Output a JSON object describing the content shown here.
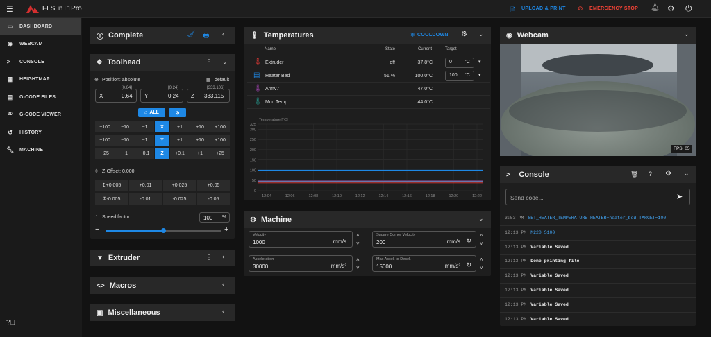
{
  "app": {
    "title": "FLSunT1Pro",
    "upload_label": "UPLOAD & PRINT",
    "estop_label": "EMERGENCY STOP"
  },
  "colors": {
    "accent": "#1e88e5",
    "danger": "#f44336",
    "brand": "#d32f2f"
  },
  "nav": [
    {
      "label": "DASHBOARD",
      "icon": "dashboard-icon"
    },
    {
      "label": "WEBCAM",
      "icon": "webcam-icon"
    },
    {
      "label": "CONSOLE",
      "icon": "console-icon"
    },
    {
      "label": "HEIGHTMAP",
      "icon": "heightmap-icon"
    },
    {
      "label": "G-CODE FILES",
      "icon": "files-icon"
    },
    {
      "label": "G-CODE VIEWER",
      "icon": "3d-icon"
    },
    {
      "label": "HISTORY",
      "icon": "history-icon"
    },
    {
      "label": "MACHINE",
      "icon": "wrench-icon"
    }
  ],
  "status": {
    "title": "Complete"
  },
  "toolhead": {
    "title": "Toolhead",
    "position_mode": "Position: absolute",
    "profile": "default",
    "axes": [
      {
        "name": "X",
        "value": "0.64",
        "live": "[0.64]"
      },
      {
        "name": "Y",
        "value": "0.24",
        "live": "[0.24]"
      },
      {
        "name": "Z",
        "value": "333.115",
        "live": "[333.106]"
      }
    ],
    "home_all": "ALL",
    "x_row": [
      "−100",
      "−10",
      "−1",
      "X",
      "+1",
      "+10",
      "+100"
    ],
    "y_row": [
      "−100",
      "−10",
      "−1",
      "Y",
      "+1",
      "+10",
      "+100"
    ],
    "z_row": [
      "−25",
      "−1",
      "−0.1",
      "Z",
      "+0.1",
      "+1",
      "+25"
    ],
    "zoffset_label": "Z-Offset: 0.000",
    "zoff_up": [
      "+0.005",
      "+0.01",
      "+0.025",
      "+0.05"
    ],
    "zoff_down": [
      "-0.005",
      "-0.01",
      "-0.025",
      "-0.05"
    ],
    "speed_label": "Speed factor",
    "speed_value": "100",
    "speed_unit": "%",
    "speed_fraction": 0.5,
    "minus": "−",
    "plus": "+"
  },
  "panels": {
    "extruder": "Extruder",
    "macros": "Macros",
    "misc": "Miscellaneous",
    "machine": "Machine",
    "webcam": "Webcam",
    "console": "Console"
  },
  "temps": {
    "title": "Temperatures",
    "cooldown": "COOLDOWN",
    "headers": [
      "Name",
      "State",
      "Current",
      "Target"
    ],
    "rows": [
      {
        "name": "Extruder",
        "state": "off",
        "current": "37.8°C",
        "target": "0",
        "unit": "°C",
        "color": "#e53935"
      },
      {
        "name": "Heater Bed",
        "state": "51 %",
        "current": "100.0°C",
        "target": "100",
        "unit": "°C",
        "color": "#1e88e5"
      },
      {
        "name": "Armv7",
        "state": "",
        "current": "47.0°C",
        "target": "",
        "unit": "",
        "color": "#ab47bc"
      },
      {
        "name": "Mcu Temp",
        "state": "",
        "current": "44.0°C",
        "target": "",
        "unit": "",
        "color": "#26a69a"
      }
    ]
  },
  "chart_data": {
    "type": "line",
    "ylabel": "Temperature [°C]",
    "ylim": [
      0,
      325
    ],
    "yticks": [
      "325",
      "300",
      "250",
      "200",
      "150",
      "100",
      "50",
      "0"
    ],
    "x": [
      "12:04",
      "12:06",
      "12:08",
      "12:10",
      "12:12",
      "12:14",
      "12:16",
      "12:18",
      "12:20",
      "12:22"
    ],
    "series": [
      {
        "name": "Heater Bed",
        "values": [
          100,
          100,
          100,
          100,
          100,
          100,
          100,
          100,
          100,
          100
        ],
        "color": "#1e88e5"
      },
      {
        "name": "Armv7",
        "values": [
          47,
          47,
          47,
          47,
          47,
          47,
          47,
          47,
          47,
          47
        ],
        "color": "#ab47bc"
      },
      {
        "name": "Mcu Temp",
        "values": [
          44,
          44,
          44,
          44,
          44,
          44,
          44,
          44,
          44,
          44
        ],
        "color": "#26a69a"
      },
      {
        "name": "Extruder",
        "values": [
          38,
          38,
          38,
          38,
          38,
          38,
          38,
          38,
          38,
          38
        ],
        "color": "#e53935"
      }
    ]
  },
  "machine": {
    "fields": [
      {
        "label": "Velocity",
        "value": "1000",
        "unit": "mm/s"
      },
      {
        "label": "Square Corner Velocity",
        "value": "200",
        "unit": "mm/s"
      },
      {
        "label": "Acceleration",
        "value": "30000",
        "unit": "mm/s²"
      },
      {
        "label": "Max Accel. to Decel.",
        "value": "15000",
        "unit": "mm/s²"
      }
    ]
  },
  "webcam": {
    "fps": "FPS: 05"
  },
  "console": {
    "placeholder": "Send code...",
    "lines": [
      {
        "time": "3:53 PM",
        "text": "SET_HEATER_TEMPERATURE HEATER=heater_bed TARGET=100",
        "style": "b"
      },
      {
        "time": "12:13 PM",
        "text": "M220 S100",
        "style": "b"
      },
      {
        "time": "12:13 PM",
        "text": "Variable Saved",
        "style": "m"
      },
      {
        "time": "12:13 PM",
        "text": "Done printing file",
        "style": "m"
      },
      {
        "time": "12:13 PM",
        "text": "Variable Saved",
        "style": "m"
      },
      {
        "time": "12:13 PM",
        "text": "Variable Saved",
        "style": "m"
      },
      {
        "time": "12:13 PM",
        "text": "Variable Saved",
        "style": "m"
      },
      {
        "time": "12:13 PM",
        "text": "Variable Saved",
        "style": "m"
      }
    ]
  }
}
